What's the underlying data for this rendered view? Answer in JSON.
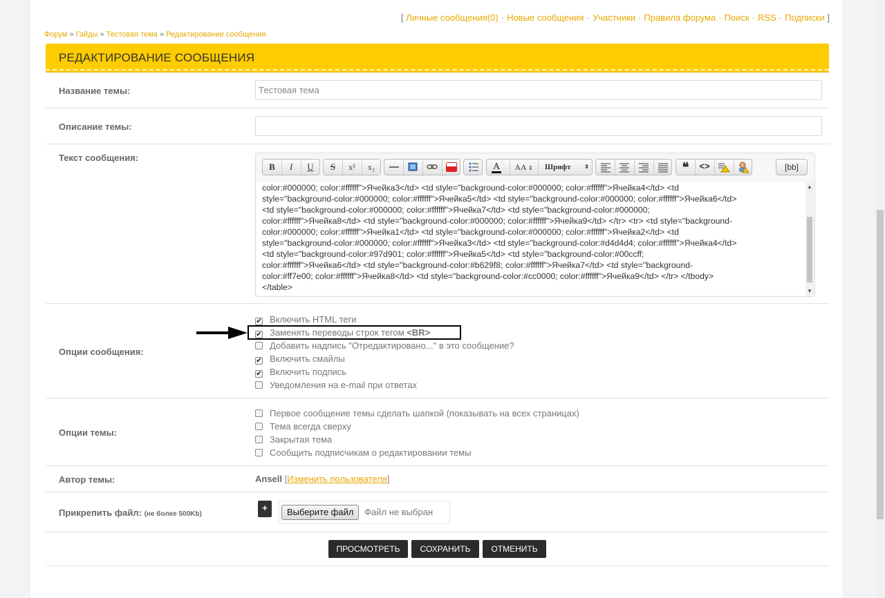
{
  "top_links": {
    "open": "[",
    "close": "]",
    "items": [
      "Личные сообщения(0)",
      "Новые сообщения",
      "Участники",
      "Правила форума",
      "Поиск",
      "RSS",
      "Подписки"
    ],
    "separator": "·"
  },
  "breadcrumb": {
    "items": [
      "Форум",
      "Гайды",
      "Тестовая тема",
      "Редактирование сообщения"
    ],
    "separator": "»"
  },
  "header": {
    "title": "РЕДАКТИРОВАНИЕ СООБЩЕНИЯ"
  },
  "topic_name": {
    "label": "Название темы:",
    "value": "Тестовая тема"
  },
  "topic_description": {
    "label": "Описание темы:",
    "value": ""
  },
  "message": {
    "label": "Текст сообщения:",
    "toolbar": {
      "bold": "B",
      "italic": "I",
      "underline": "U",
      "strike": "S",
      "sup": "x²",
      "sub": "x₂",
      "font_size": "AA",
      "font": "Шрифт",
      "bb": "[bb]"
    },
    "text": "color:#000000; color:#ffffff\">Ячейка3</td> <td style=\"background-color:#000000; color:#ffffff\">Ячейка4</td> <td\nstyle=\"background-color:#000000; color:#ffffff\">Ячейка5</td> <td style=\"background-color:#000000; color:#ffffff\">Ячейка6</td>\n<td style=\"background-color:#000000; color:#ffffff\">Ячейка7</td> <td style=\"background-color:#000000;\ncolor:#ffffff\">Ячейка8</td> <td style=\"background-color:#000000; color:#ffffff\">Ячейка9</td> </tr> <tr> <td style=\"background-\ncolor:#000000; color:#ffffff\">Ячейка1</td> <td style=\"background-color:#000000; color:#ffffff\">Ячейка2</td> <td\nstyle=\"background-color:#000000; color:#ffffff\">Ячейка3</td> <td style=\"background-color:#d4d4d4; color:#ffffff\">Ячейка4</td>\n<td style=\"background-color:#97d901; color:#ffffff\">Ячейка5</td> <td style=\"background-color:#00ccff;\ncolor:#ffffff\">Ячейка6</td> <td style=\"background-color:#b629f8; color:#ffffff\">Ячейка7</td> <td style=\"background-\ncolor:#ff7e00; color:#ffffff\">Ячейка8</td> <td style=\"background-color:#cc0000; color:#ffffff\">Ячейка9</td> </tr> </tbody>\n</table>"
  },
  "message_options": {
    "label": "Опции сообщения:",
    "items": [
      {
        "label": "Включить HTML теги",
        "checked": true
      },
      {
        "label": "Заменять переводы строк тегом",
        "tag": "<BR>",
        "checked": true
      },
      {
        "label": "Добавить надпись \"Отредактировано...\" в это сообщение?",
        "checked": false
      },
      {
        "label": "Включить смайлы",
        "checked": true
      },
      {
        "label": "Включить подпись",
        "checked": true
      },
      {
        "label": "Уведомления на e-mail при ответах",
        "checked": false
      }
    ]
  },
  "topic_options": {
    "label": "Опции темы:",
    "items": [
      {
        "label": "Первое сообщение темы сделать шапкой (показывать на всех страницах)",
        "checked": false
      },
      {
        "label": "Тема всегда сверху",
        "checked": false
      },
      {
        "label": "Закрытая тема",
        "checked": false
      },
      {
        "label": "Сообщить подписчикам о редактировании темы",
        "checked": false
      }
    ]
  },
  "author": {
    "label": "Автор темы:",
    "name": "Ansell",
    "change_link": "Изменить пользователя"
  },
  "attach": {
    "label": "Прикрепить файл:",
    "note": "(не более 500Kb)",
    "plus": "+",
    "choose_button": "Выберите файл",
    "status": "Файл не выбран"
  },
  "actions": {
    "preview": "ПРОСМОТРЕТЬ",
    "save": "СОХРАНИТЬ",
    "cancel": "ОТМЕНИТЬ"
  },
  "colors": {
    "accent": "#ffcc00",
    "link": "#e8a800",
    "button": "#2b2b2b"
  }
}
